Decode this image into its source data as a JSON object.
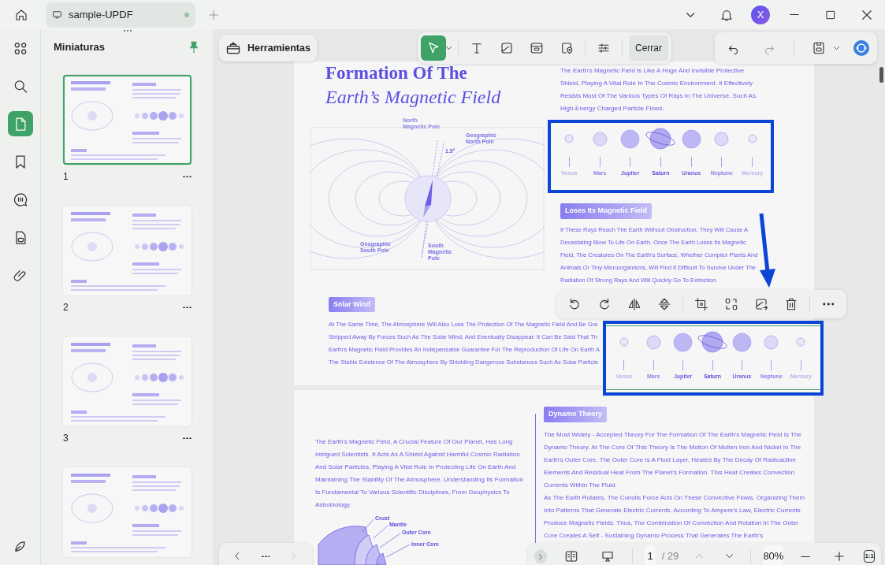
{
  "tab": {
    "title": "sample-UPDF",
    "unsaved": true
  },
  "avatar": "X",
  "rail": [
    {
      "kind": "apps",
      "selected": false
    },
    {
      "kind": "search",
      "selected": false
    },
    {
      "kind": "pages",
      "selected": true
    },
    {
      "kind": "bookmark",
      "selected": false
    },
    {
      "kind": "comment",
      "selected": false
    },
    {
      "kind": "form",
      "selected": false
    },
    {
      "kind": "attachment",
      "selected": false
    }
  ],
  "thumbnails": {
    "title": "Miniaturas",
    "pages": [
      {
        "number": "1",
        "selected": true
      },
      {
        "number": "2",
        "selected": false
      },
      {
        "number": "3",
        "selected": false
      },
      {
        "selected": false
      }
    ]
  },
  "tools_button": "Herramientas",
  "edit_toolbar": {
    "tools": [
      {
        "kind": "select",
        "selected": true
      },
      {
        "kind": "text",
        "selected": false
      },
      {
        "kind": "image",
        "selected": false
      },
      {
        "kind": "link",
        "selected": false
      },
      {
        "kind": "location",
        "selected": false
      },
      {
        "kind": "settings",
        "selected": false
      }
    ],
    "close": "Cerrar"
  },
  "image_toolbar": [
    {
      "kind": "rotate-left"
    },
    {
      "kind": "rotate-right"
    },
    {
      "kind": "flip-h"
    },
    {
      "kind": "flip-v"
    },
    {
      "kind": "crop"
    },
    {
      "kind": "replace"
    },
    {
      "kind": "extract"
    },
    {
      "kind": "delete"
    },
    {
      "kind": "more"
    }
  ],
  "page1": {
    "title": "Formation Of The",
    "subtitle": "Earth’s Magnetic Field",
    "intro": "The Earth's Magnetic Field Is Like A Huge And Invisible Protective Shield, Playing A Vital Role In The Cosmic Environment. It Effectively Resists Most Of The Various Types Of Rays In The Universe, Such As High-Energy Charged Particle Flows.",
    "diagram_labels": [
      {
        "lines": [
          "North",
          "Magnetic Pole"
        ]
      },
      {
        "lines": [
          "Geographic",
          "North Pole"
        ]
      },
      {
        "lines": [
          "1.5°"
        ]
      },
      {
        "lines": [
          "Geographic",
          "South Pole"
        ]
      },
      {
        "lines": [
          "South",
          "Magnetic",
          "Pole"
        ]
      }
    ],
    "planets": [
      {
        "label": "Venus",
        "kind": "small"
      },
      {
        "label": "Mars",
        "kind": "medium"
      },
      {
        "label": "Jupiter",
        "kind": "large"
      },
      {
        "label": "Saturn",
        "kind": "ringed"
      },
      {
        "label": "Uranus",
        "kind": "large"
      },
      {
        "label": "Neptune",
        "kind": "medium"
      },
      {
        "label": "Mercury",
        "kind": "small"
      }
    ],
    "loses_heading": "Loses Its Magnetic Field",
    "loses_text": "If These Rays Reach The Earth Without Obstruction, They Will Cause A Devastating Blow To Life On Earth. Once The Earth Loses Its Magnetic Field, The Creatures On The Earth's Surface, Whether Complex Plants And Animals Or Tiny Microorganisms, Will Find It Difficult To Survive Under The Radiation Of Strong Rays And Will Quickly Go To Extinction.",
    "solar_heading": "Solar Wind",
    "solar_lines": [
      "At The Same Time, The Atmosphere Will Also Lose The Protection Of The Magnetic Field And Be Gra",
      "Stripped Away By Forces Such As The Solar Wind, And Eventually Disappear. It Can Be Said That Th",
      "Earth's Magnetic Field Provides An Indispensable Guarantee For The Reproduction Of Life On Earth A",
      "The Stable Existence Of The Atmosphere By Shielding Dangerous Substances Such As Solar Particle"
    ],
    "selected_image": {
      "planets": [
        {
          "label": "Venus",
          "kind": "small"
        },
        {
          "label": "Mars",
          "kind": "medium"
        },
        {
          "label": "Jupiter",
          "kind": "large"
        },
        {
          "label": "Saturn",
          "kind": "ringed"
        },
        {
          "label": "Uranus",
          "kind": "large"
        },
        {
          "label": "Neptune",
          "kind": "medium"
        },
        {
          "label": "Mercury",
          "kind": "small"
        }
      ]
    }
  },
  "page2": {
    "intro": "The Earth's Magnetic Field, A Crucial Feature Of Our Planet, Has Long Intrigued Scientists. It Acts As A Shield Against Harmful Cosmic Radiation And Solar Particles, Playing A Vital Role In Protecting Life On Earth And Maintaining The Stability Of The Atmosphere. Understanding Its Formation Is Fundamental To Various Scientific Disciplines, From Geophysics To Astrobiology.",
    "layers": [
      "Crust",
      "Mantle",
      "Outer Core",
      "Inner Core"
    ],
    "dynamo_heading": "Dynamo Theory",
    "dynamo_paragraphs": [
      "The Most Widely - Accepted Theory For The Formation Of The Earth's Magnetic Field Is The Dynamo Theory. At The Core Of This Theory Is The Motion Of Molten Iron And Nickel In The Earth's Outer Core. The Outer Core Is A Fluid Layer, Heated By The Decay Of Radioactive Elements And Residual Heat From The Planet's Formation. This Heat Creates Convection Currents Within The Fluid.",
      "As The Earth Rotates, The Coriolis Force Acts On These Convective Flows, Organizing Them Into Patterns That Generate Electric Currents. According To Ampere's Law, Electric Currents Produce Magnetic Fields. Thus, The Combination Of Convection And Rotation In The Outer Core Creates A Self - Sustaining Dynamo Process That Generates The Earth's"
    ]
  },
  "bottom_bar": {
    "page": "1",
    "total": "/ 29",
    "zoom": "80%",
    "actual_size": "1:1"
  }
}
